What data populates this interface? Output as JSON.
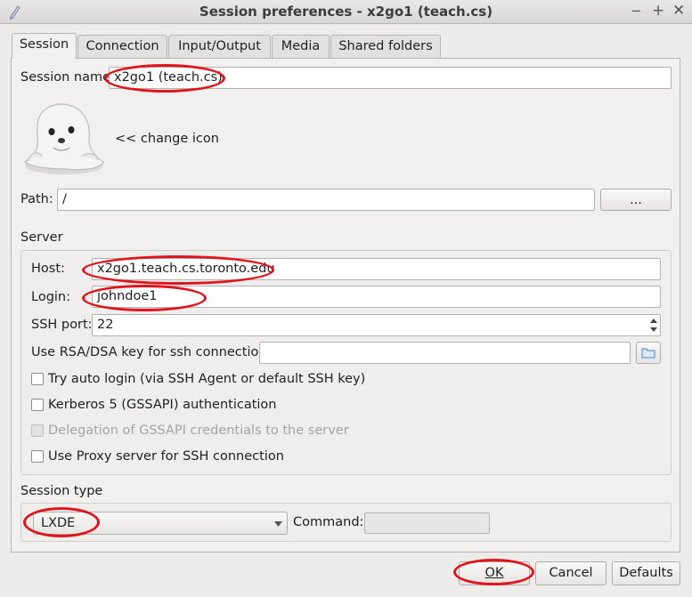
{
  "window": {
    "title": "Session preferences - x2go1 (teach.cs)"
  },
  "tabs": [
    {
      "label": "Session"
    },
    {
      "label": "Connection"
    },
    {
      "label": "Input/Output"
    },
    {
      "label": "Media"
    },
    {
      "label": "Shared folders"
    }
  ],
  "session": {
    "name_label": "Session name:",
    "name_value": "x2go1 (teach.cs)",
    "change_icon_label": "<< change icon",
    "path_label": "Path:",
    "path_value": "/",
    "browse_label": "..."
  },
  "server": {
    "group_title": "Server",
    "host_label": "Host:",
    "host_value": "x2go1.teach.cs.toronto.edu",
    "login_label": "Login:",
    "login_value": "johndoe1",
    "ssh_port_label": "SSH port:",
    "ssh_port_value": "22",
    "rsa_label": "Use RSA/DSA key for ssh connection:",
    "rsa_value": "",
    "auto_login_label": "Try auto login (via SSH Agent or default SSH key)",
    "kerberos_label": "Kerberos 5 (GSSAPI) authentication",
    "delegation_label": "Delegation of GSSAPI credentials to the server",
    "proxy_label": "Use Proxy server for SSH connection"
  },
  "session_type": {
    "group_title": "Session type",
    "selected": "LXDE",
    "command_label": "Command:",
    "command_value": ""
  },
  "buttons": {
    "ok": "OK",
    "cancel": "Cancel",
    "defaults": "Defaults"
  },
  "colors": {
    "annotation": "#e0141a"
  },
  "icons": [
    "pen-icon",
    "seal-icon",
    "folder-icon",
    "minimize-icon",
    "maximize-icon",
    "close-icon",
    "dropdown-arrow-icon",
    "spin-arrows-icon"
  ]
}
